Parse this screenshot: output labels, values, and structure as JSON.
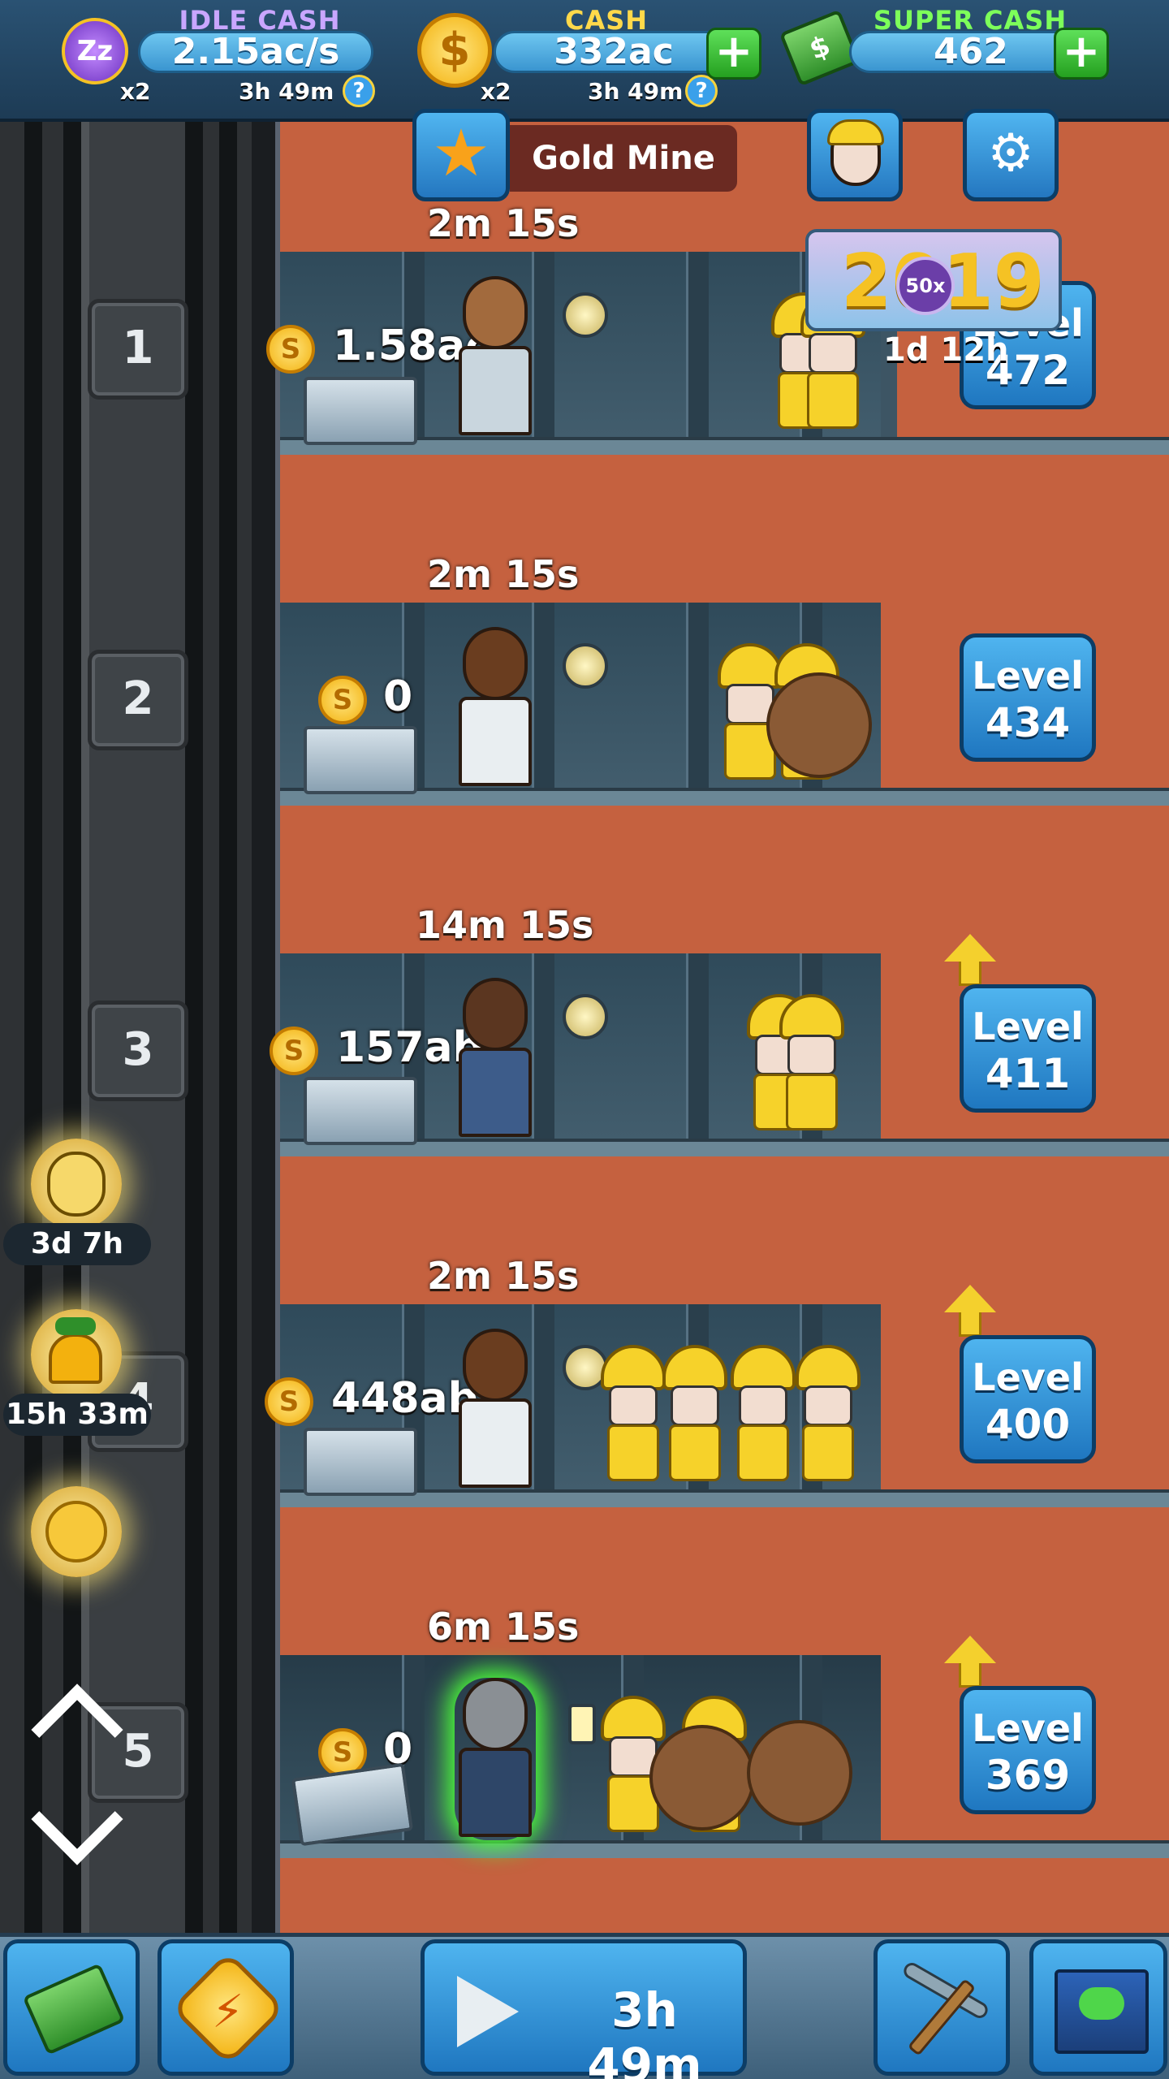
{
  "currency": {
    "idle": {
      "title": "IDLE CASH",
      "value": "2.15ac/s",
      "multiplier": "x2",
      "timer": "3h 49m",
      "help": "?"
    },
    "cash": {
      "title": "CASH",
      "value": "332ac",
      "multiplier": "x2",
      "timer": "3h 49m",
      "help": "?",
      "plus": "+"
    },
    "super": {
      "title": "SUPER CASH",
      "value": "462",
      "plus": "+"
    },
    "colors": {
      "idle_title": "#c9a6ff",
      "cash_title": "#ffd94a",
      "super_title": "#7dff5a"
    }
  },
  "header": {
    "mine_name": "Gold Mine",
    "star_icon": "★",
    "settings_icon": "⚙"
  },
  "event": {
    "year": "2019",
    "multiplier": "50x",
    "timer": "1d 12h"
  },
  "shafts": [
    {
      "number": "1",
      "timer": "2m 15s",
      "amount": "1.58ac",
      "level_label": "Level",
      "level": "472"
    },
    {
      "number": "2",
      "timer": "2m 15s",
      "amount": "0",
      "level_label": "Level",
      "level": "434"
    },
    {
      "number": "3",
      "timer": "14m 15s",
      "amount": "157ab",
      "level_label": "Level",
      "level": "411"
    },
    {
      "number": "4",
      "timer": "2m 15s",
      "amount": "448ab",
      "level_label": "Level",
      "level": "400"
    },
    {
      "number": "5",
      "timer": "6m 15s",
      "amount": "0",
      "level_label": "Level",
      "level": "369"
    }
  ],
  "coin_symbol": "S",
  "boosts": [
    {
      "timer": "3d 7h"
    },
    {
      "timer": "15h 33m"
    }
  ],
  "bottom_nav": {
    "play_timer": "3h 49m"
  }
}
